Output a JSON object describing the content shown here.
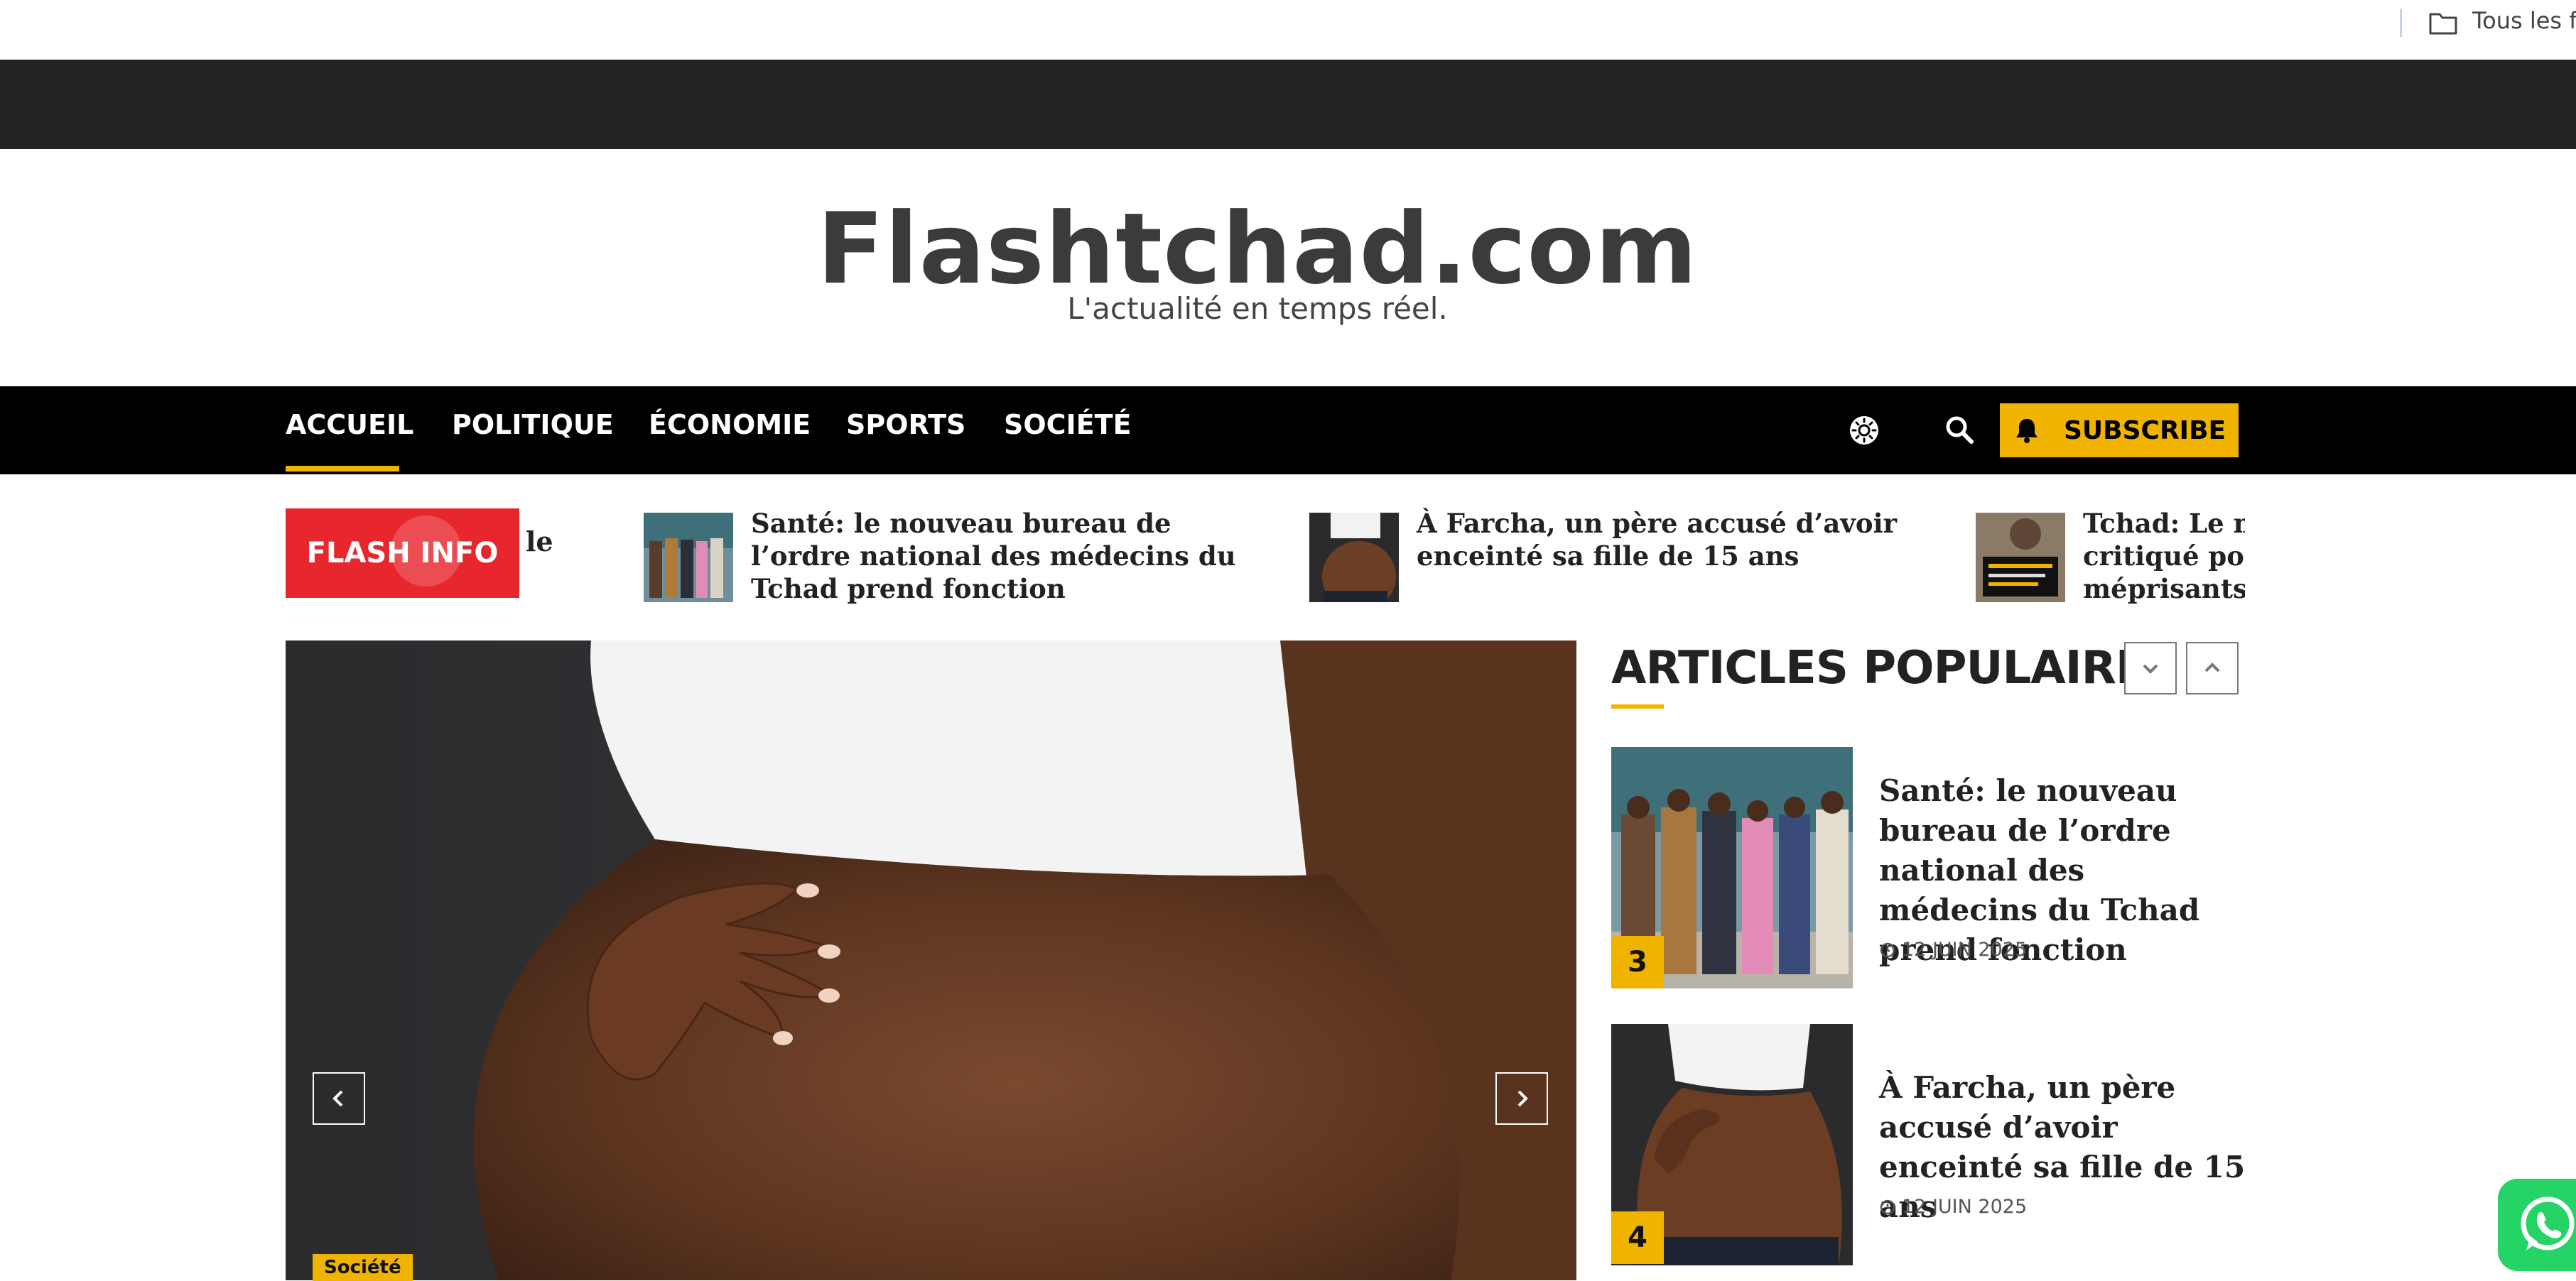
{
  "browser": {
    "bookmark_folder_label": "Tous les fav"
  },
  "site": {
    "title": "Flashtchad.com",
    "tagline": "L'actualité en temps réel."
  },
  "nav": {
    "items": [
      {
        "label": "ACCUEIL",
        "active": true
      },
      {
        "label": "POLITIQUE"
      },
      {
        "label": "ÉCONOMIE"
      },
      {
        "label": "SPORTS"
      },
      {
        "label": "SOCIÉTÉ"
      }
    ],
    "subscribe_label": "SUBSCRIBE",
    "accent_color": "#f0b400"
  },
  "ticker": {
    "badge_label": "FLASH INFO",
    "badge_color": "#e8262d",
    "fragment": "le",
    "items": [
      {
        "title": "Santé: le nouveau bureau de l’ordre national des médecins du Tchad prend fonction"
      },
      {
        "title": "À Farcha, un père accusé d’avoir enceinté sa fille de 15 ans"
      },
      {
        "title": "Tchad: Le mi critiqué pou méprisants e"
      }
    ]
  },
  "slider": {
    "category": "Société"
  },
  "popular": {
    "heading": "ARTICLES POPULAIRES",
    "items": [
      {
        "rank": "3",
        "title": "Santé: le nouveau bureau de l’ordre national des médecins du Tchad prend fonction",
        "date": "12 JUIN 2025"
      },
      {
        "rank": "4",
        "title": "À Farcha, un père accusé d’avoir enceinté sa fille de 15 ans",
        "date": "12 JUIN 2025"
      }
    ]
  }
}
